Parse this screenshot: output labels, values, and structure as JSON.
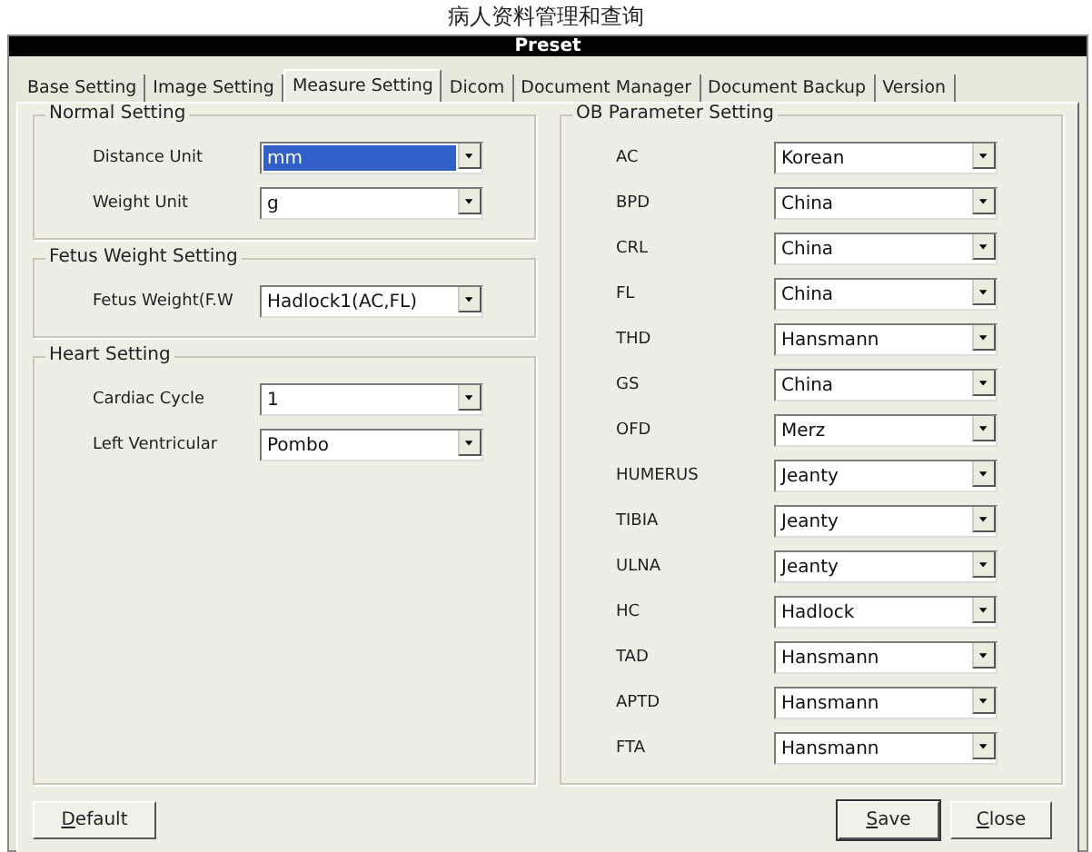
{
  "page_title": "病人资料管理和查询",
  "window": {
    "title": "Preset"
  },
  "tabs": [
    {
      "label": "Base Setting",
      "selected": false
    },
    {
      "label": "Image Setting",
      "selected": false
    },
    {
      "label": "Measure Setting",
      "selected": true
    },
    {
      "label": "Dicom",
      "selected": false
    },
    {
      "label": "Document Manager",
      "selected": false
    },
    {
      "label": "Document Backup",
      "selected": false
    },
    {
      "label": "Version",
      "selected": false
    }
  ],
  "left_groups": [
    {
      "title": "Normal Setting",
      "fields": [
        {
          "label": "Distance Unit",
          "value": "mm",
          "selected": true
        },
        {
          "label": "Weight Unit",
          "value": "g",
          "selected": false
        }
      ]
    },
    {
      "title": "Fetus Weight Setting",
      "fields": [
        {
          "label": "Fetus Weight(F.W",
          "value": "Hadlock1(AC,FL)",
          "selected": false
        }
      ]
    },
    {
      "title": "Heart Setting",
      "fields": [
        {
          "label": "Cardiac Cycle",
          "value": "1",
          "selected": false
        },
        {
          "label": "Left Ventricular",
          "value": "Pombo",
          "selected": false
        }
      ]
    }
  ],
  "ob_group": {
    "title": "OB Parameter Setting",
    "fields": [
      {
        "label": "AC",
        "value": "Korean",
        "selected": false
      },
      {
        "label": "BPD",
        "value": "China",
        "selected": false
      },
      {
        "label": "CRL",
        "value": "China",
        "selected": false
      },
      {
        "label": "FL",
        "value": "China",
        "selected": false
      },
      {
        "label": "THD",
        "value": "Hansmann",
        "selected": false
      },
      {
        "label": "GS",
        "value": "China",
        "selected": false
      },
      {
        "label": "OFD",
        "value": "Merz",
        "selected": false
      },
      {
        "label": "HUMERUS",
        "value": "Jeanty",
        "selected": false
      },
      {
        "label": "TIBIA",
        "value": "Jeanty",
        "selected": false
      },
      {
        "label": "ULNA",
        "value": "Jeanty",
        "selected": false
      },
      {
        "label": "HC",
        "value": "Hadlock",
        "selected": false
      },
      {
        "label": "TAD",
        "value": "Hansmann",
        "selected": false
      },
      {
        "label": "APTD",
        "value": "Hansmann",
        "selected": false
      },
      {
        "label": "FTA",
        "value": "Hansmann",
        "selected": false
      }
    ]
  },
  "buttons": [
    {
      "label": "Default",
      "kind": "left",
      "mnemonic_first": true,
      "focused": false
    },
    {
      "label": "Save",
      "kind": "right",
      "mnemonic_first": true,
      "focused": true
    },
    {
      "label": "Close",
      "kind": "right",
      "mnemonic_first": true,
      "focused": false
    }
  ]
}
